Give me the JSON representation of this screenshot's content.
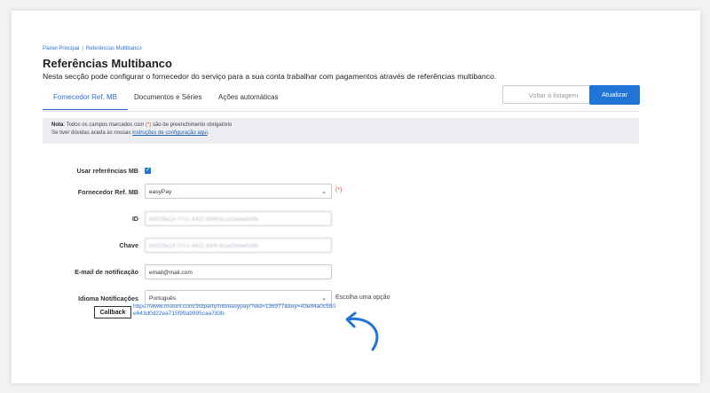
{
  "breadcrumb": {
    "home": "Painel Principal",
    "current": "Referências Multibanco"
  },
  "page": {
    "title": "Referências Multibanco",
    "description": "Nesta secção pode configurar o fornecedor do serviço para a sua conta trabalhar com pagamentos através de referências multibanco."
  },
  "tabs": [
    {
      "label": "Fornecedor Ref. MB",
      "active": true
    },
    {
      "label": "Documentos e Séries",
      "active": false
    },
    {
      "label": "Ações automáticas",
      "active": false
    }
  ],
  "actions": {
    "back_label": "Voltar à listagem",
    "update_label": "Atualizar"
  },
  "note": {
    "prefix": "Nota",
    "text1": ": Todos os campos marcados com ",
    "required_marker": "(*)",
    "text2": " são de preenchimento obrigatório",
    "help_text": "Se tiver dúvidas aceda às nossas ",
    "help_link": "instruções de configuração aqui",
    "help_end": "."
  },
  "form": {
    "use_mb": {
      "label": "Usar referências MB",
      "checked": true
    },
    "provider": {
      "label": "Fornecedor Ref. MB",
      "value": "easyPay",
      "required_marker": "(*)"
    },
    "id": {
      "label": "ID",
      "value": "b3519a13-77c1-4411-834f-6ca10dae8e9b"
    },
    "key": {
      "label": "Chave",
      "value": "b3519a13-77c1-4411-834f-6ca10dae8e9b"
    },
    "email": {
      "label": "E-mail de notificação",
      "value": "email@mail.com"
    },
    "language": {
      "label": "Idioma Notificações",
      "value": "Português",
      "hint": "Escolha uma opção"
    }
  },
  "callback": {
    "button_label": "Callback",
    "url": "https://www.moloni.com/3rdparty/mb/easypay/?eid=136977&key=43e84a0c580e643d0d22ea715f99a9995caa783b"
  },
  "colors": {
    "accent": "#1f74d6",
    "required": "#e04b3a",
    "note_bg": "#eceef1"
  }
}
